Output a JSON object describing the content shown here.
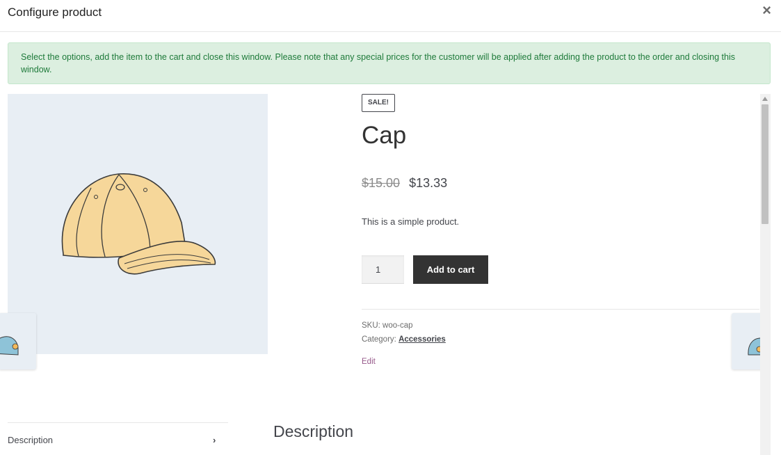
{
  "modal": {
    "title": "Configure product",
    "close_icon": "×"
  },
  "notice": {
    "text": "Select the options, add the item to the cart and close this window. Please note that any special prices for the customer will be applied after adding the product to the order and closing this window."
  },
  "product": {
    "sale_badge": "SALE!",
    "title": "Cap",
    "old_price": "$15.00",
    "new_price": "$13.33",
    "short_description": "This is a simple product.",
    "quantity": "1",
    "add_to_cart_label": "Add to cart",
    "sku_label": "SKU:",
    "sku_value": "woo-cap",
    "category_label": "Category:",
    "category_value": "Accessories",
    "edit_label": "Edit",
    "image_icon": "cap-illustration"
  },
  "tabs": {
    "description_label": "Description",
    "chevron": "›"
  },
  "description": {
    "heading": "Description"
  },
  "colors": {
    "notice_bg": "#dcefe0",
    "notice_text": "#1e7a3a",
    "button_bg": "#333333",
    "edit_link": "#96588a",
    "image_bg": "#e8eef4"
  }
}
